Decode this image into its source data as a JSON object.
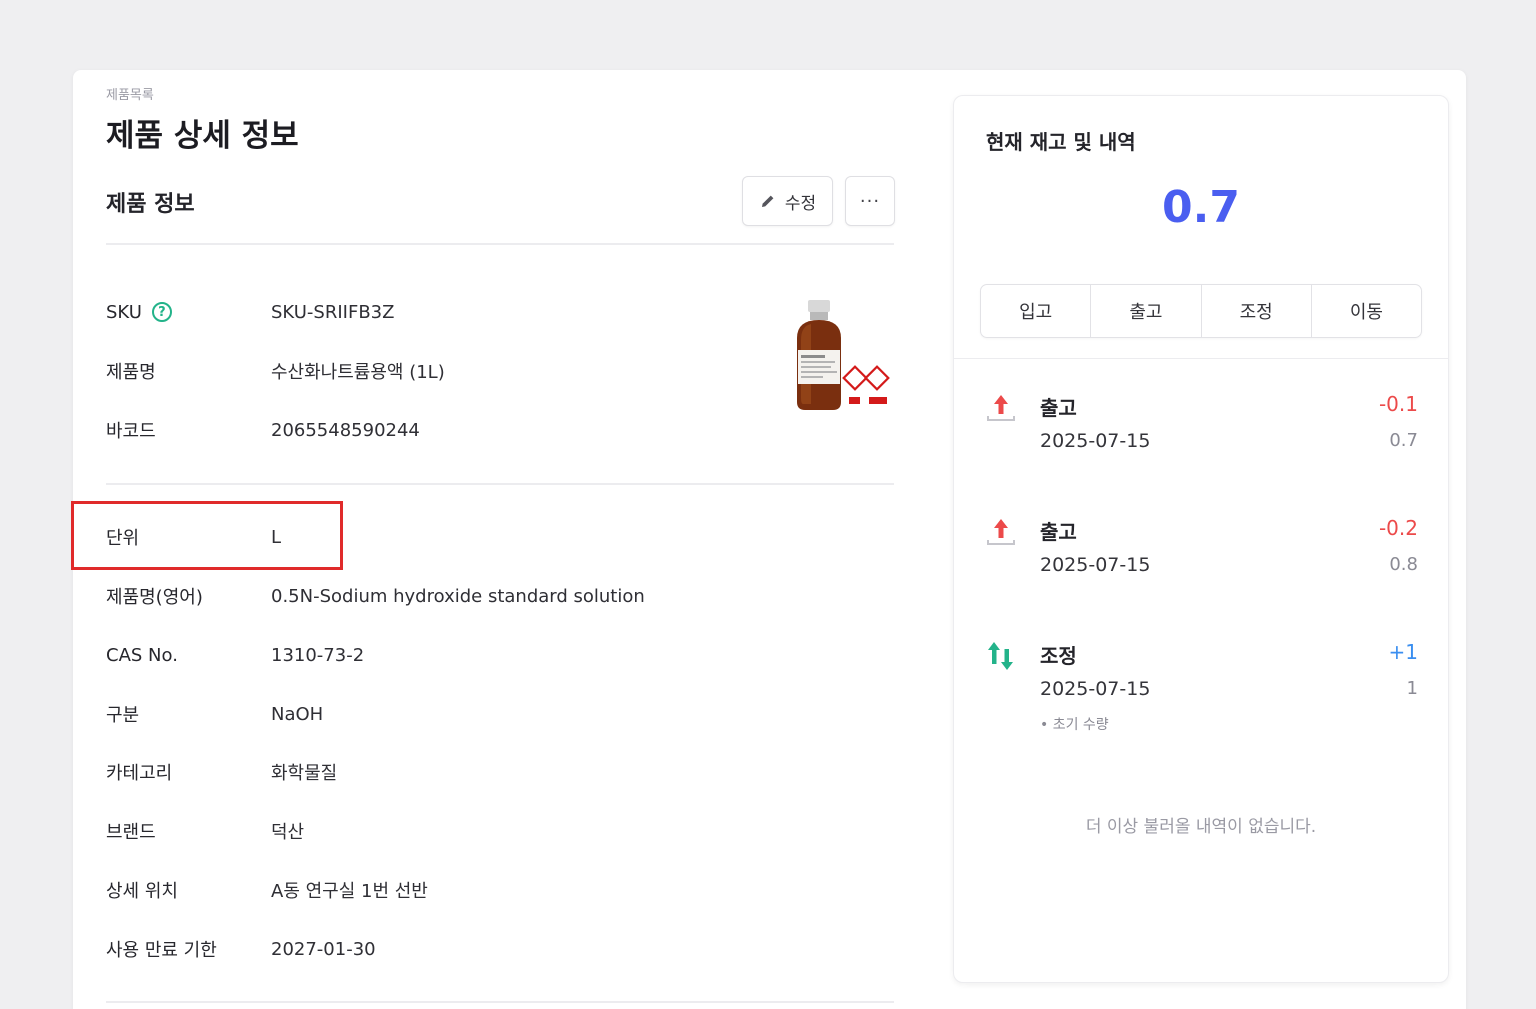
{
  "breadcrumb": "제품목록",
  "page_title": "제품 상세 정보",
  "section_title": "제품 정보",
  "actions": {
    "edit_label": "수정",
    "more_label": "···"
  },
  "fields_top": [
    {
      "label": "SKU",
      "value": "SKU-SRIIFB3Z",
      "help": "?"
    },
    {
      "label": "제품명",
      "value": "수산화나트륨용액 (1L)"
    },
    {
      "label": "바코드",
      "value": "2065548590244"
    }
  ],
  "fields_bottom": [
    {
      "label": "단위",
      "value": "L"
    },
    {
      "label": "제품명(영어)",
      "value": "0.5N-Sodium hydroxide standard solution"
    },
    {
      "label": "CAS No.",
      "value": "1310-73-2"
    },
    {
      "label": "구분",
      "value": "NaOH"
    },
    {
      "label": "카테고리",
      "value": "화학물질"
    },
    {
      "label": "브랜드",
      "value": "덕산"
    },
    {
      "label": "상세 위치",
      "value": "A동 연구실 1번 선반"
    },
    {
      "label": "사용 만료 기한",
      "value": "2027-01-30"
    }
  ],
  "stock": {
    "title": "현재 재고 및 내역",
    "current": "0.7",
    "tabs": [
      "입고",
      "출고",
      "조정",
      "이동"
    ],
    "transactions": [
      {
        "type": "출고",
        "date": "2025-07-15",
        "delta": "-0.1",
        "balance": "0.7",
        "icon": "arrow-up-out-icon",
        "sign": "neg"
      },
      {
        "type": "출고",
        "date": "2025-07-15",
        "delta": "-0.2",
        "balance": "0.8",
        "icon": "arrow-up-out-icon",
        "sign": "neg"
      },
      {
        "type": "조정",
        "date": "2025-07-15",
        "delta": "+1",
        "balance": "1",
        "icon": "adjust-arrows-icon",
        "sign": "pos",
        "note": "• 초기 수량"
      }
    ],
    "no_more": "더 이상 불러올 내역이 없습니다."
  },
  "colors": {
    "accent": "#4a5ef0",
    "negative": "#ec4a4a",
    "positive": "#3a8ef0",
    "help": "#23b38a",
    "highlight": "#e02a2a"
  }
}
